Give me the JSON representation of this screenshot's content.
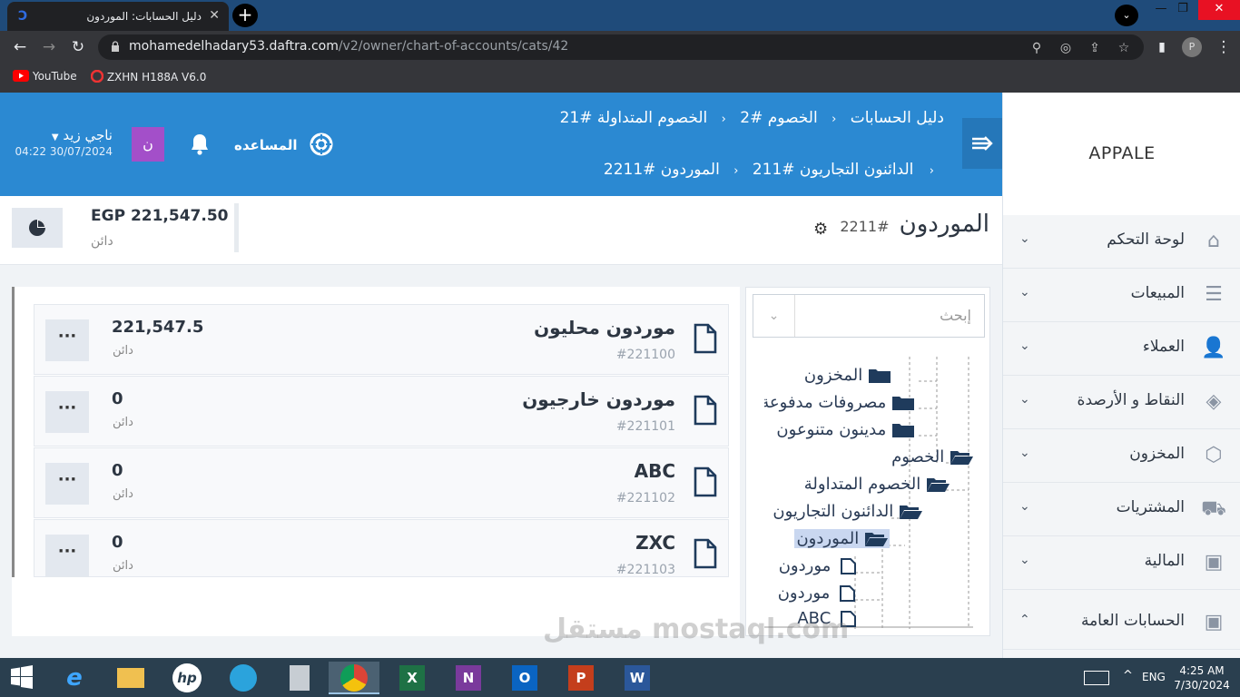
{
  "browser": {
    "tab_title": "دليل الحسابات: الموردون",
    "url_host": "mohamedelhadary53.daftra.com",
    "url_path": "/v2/owner/chart-of-accounts/cats/42",
    "bookmarks": [
      "YouTube",
      "ZXHN H188A V6.0"
    ],
    "profile_initial": "P"
  },
  "topbar": {
    "breadcrumb_row1": [
      "دليل الحسابات",
      "الخصوم #2",
      "الخصوم المتداولة #21"
    ],
    "breadcrumb_row2": [
      "الدائنون التجاريون #211",
      "الموردون #2211"
    ],
    "help_label": "المساعده",
    "user_name": "ناجي زيد",
    "user_datetime": "04:22 30/07/2024",
    "user_initial": "ن"
  },
  "sidebar": {
    "brand": "APPALE",
    "items": [
      {
        "label": "لوحة التحكم",
        "icon": "home-icon",
        "chev": "⌄"
      },
      {
        "label": "المبيعات",
        "icon": "receipt-icon",
        "chev": "⌄"
      },
      {
        "label": "العملاء",
        "icon": "user-icon",
        "chev": "⌄"
      },
      {
        "label": "النقاط و الأرصدة",
        "icon": "layers-icon",
        "chev": "⌄"
      },
      {
        "label": "المخزون",
        "icon": "box-icon",
        "chev": "⌄"
      },
      {
        "label": "المشتريات",
        "icon": "truck-icon",
        "chev": "⌄"
      },
      {
        "label": "المالية",
        "icon": "money-icon",
        "chev": "⌄"
      },
      {
        "label": "الحسابات العامة",
        "icon": "money-icon",
        "chev": "⌃"
      }
    ]
  },
  "header": {
    "title": "الموردون",
    "code": "#2211",
    "balance": "EGP 221,547.50",
    "balance_type": "دائن"
  },
  "accounts": [
    {
      "name": "موردون محليون",
      "code": "#221100",
      "amount": "221,547.5",
      "type": "دائن"
    },
    {
      "name": "موردون خارجيون",
      "code": "#221101",
      "amount": "0",
      "type": "دائن"
    },
    {
      "name": "ABC",
      "code": "#221102",
      "amount": "0",
      "type": "دائن"
    },
    {
      "name": "ZXC",
      "code": "#221103",
      "amount": "0",
      "type": "دائن"
    }
  ],
  "tree": {
    "search_placeholder": "إبحث",
    "nodes": [
      "المخزون",
      "مصروفات مدفوعة",
      "مدينون متنوعون",
      "الخصوم",
      "الخصوم المتداولة",
      "الدائنون التجاريون",
      "الموردون",
      "موردون",
      "موردون",
      "ABC"
    ]
  },
  "taskbar": {
    "lang": "ENG",
    "time": "4:25 AM",
    "date": "7/30/2024"
  },
  "watermark": "مستقل mostaql.com"
}
